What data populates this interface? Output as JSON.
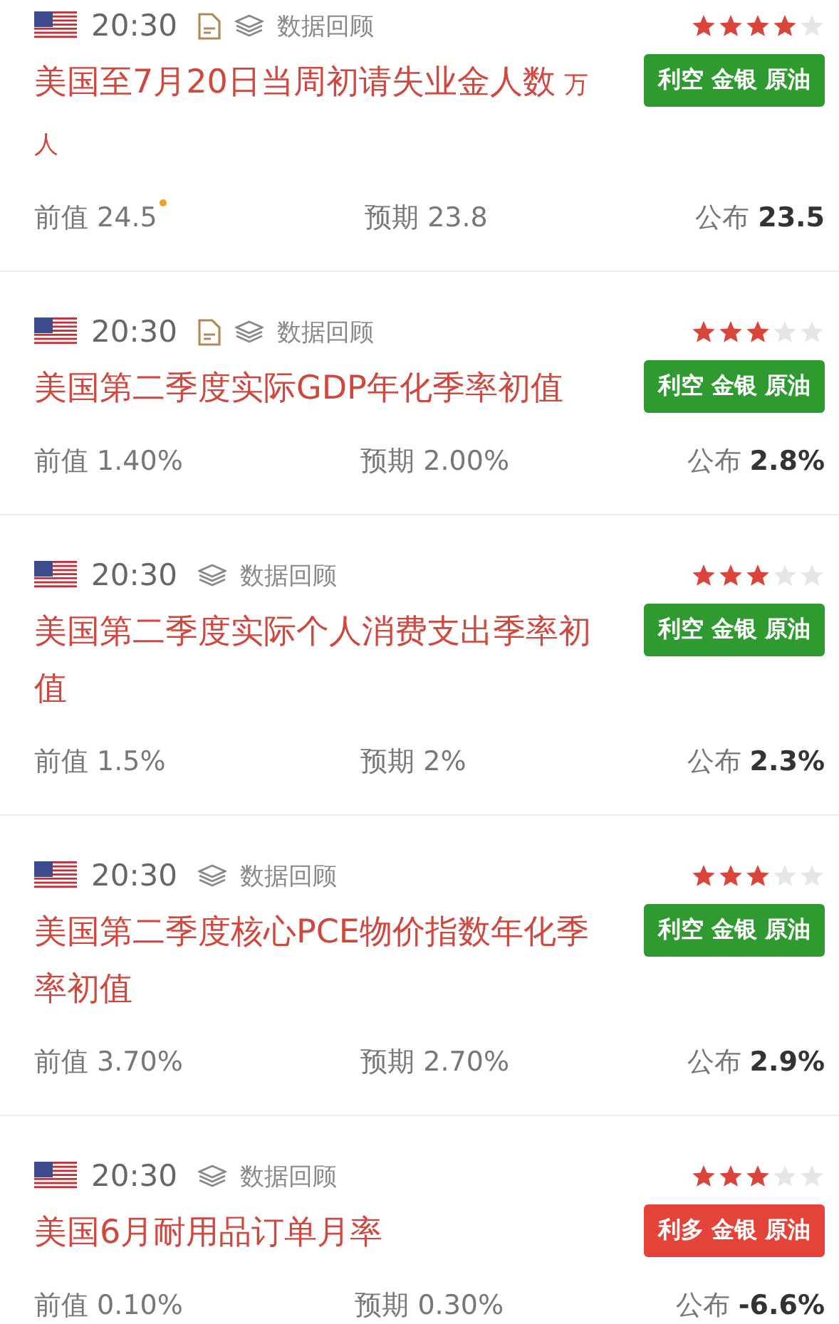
{
  "events": [
    {
      "time": "20:30",
      "has_doc": true,
      "review": "数据回顾",
      "stars": 4,
      "title": "美国至7月20日当周初请失业金人数",
      "unit": "万人",
      "tag": {
        "kind": "bearish",
        "text": "利空 金银 原油"
      },
      "prev_label": "前值",
      "prev": "24.5",
      "revised": true,
      "forecast_label": "预期",
      "forecast": "23.8",
      "actual_label": "公布",
      "actual": "23.5"
    },
    {
      "time": "20:30",
      "has_doc": true,
      "review": "数据回顾",
      "stars": 3,
      "title": "美国第二季度实际GDP年化季率初值",
      "tag": {
        "kind": "bearish",
        "text": "利空 金银 原油"
      },
      "prev_label": "前值",
      "prev": "1.40%",
      "revised": false,
      "forecast_label": "预期",
      "forecast": "2.00%",
      "actual_label": "公布",
      "actual": "2.8%"
    },
    {
      "time": "20:30",
      "has_doc": false,
      "review": "数据回顾",
      "stars": 3,
      "title": "美国第二季度实际个人消费支出季率初值",
      "tag": {
        "kind": "bearish",
        "text": "利空 金银 原油"
      },
      "prev_label": "前值",
      "prev": "1.5%",
      "revised": false,
      "forecast_label": "预期",
      "forecast": "2%",
      "actual_label": "公布",
      "actual": "2.3%"
    },
    {
      "time": "20:30",
      "has_doc": false,
      "review": "数据回顾",
      "stars": 3,
      "title": "美国第二季度核心PCE物价指数年化季率初值",
      "tag": {
        "kind": "bearish",
        "text": "利空 金银 原油"
      },
      "prev_label": "前值",
      "prev": "3.70%",
      "revised": false,
      "forecast_label": "预期",
      "forecast": "2.70%",
      "actual_label": "公布",
      "actual": "2.9%"
    },
    {
      "time": "20:30",
      "has_doc": false,
      "review": "数据回顾",
      "stars": 3,
      "title": "美国6月耐用品订单月率",
      "tag": {
        "kind": "bullish",
        "text": "利多 金银 原油"
      },
      "prev_label": "前值",
      "prev": "0.10%",
      "revised": false,
      "forecast_label": "预期",
      "forecast": "0.30%",
      "actual_label": "公布",
      "actual": "-6.6%"
    }
  ]
}
